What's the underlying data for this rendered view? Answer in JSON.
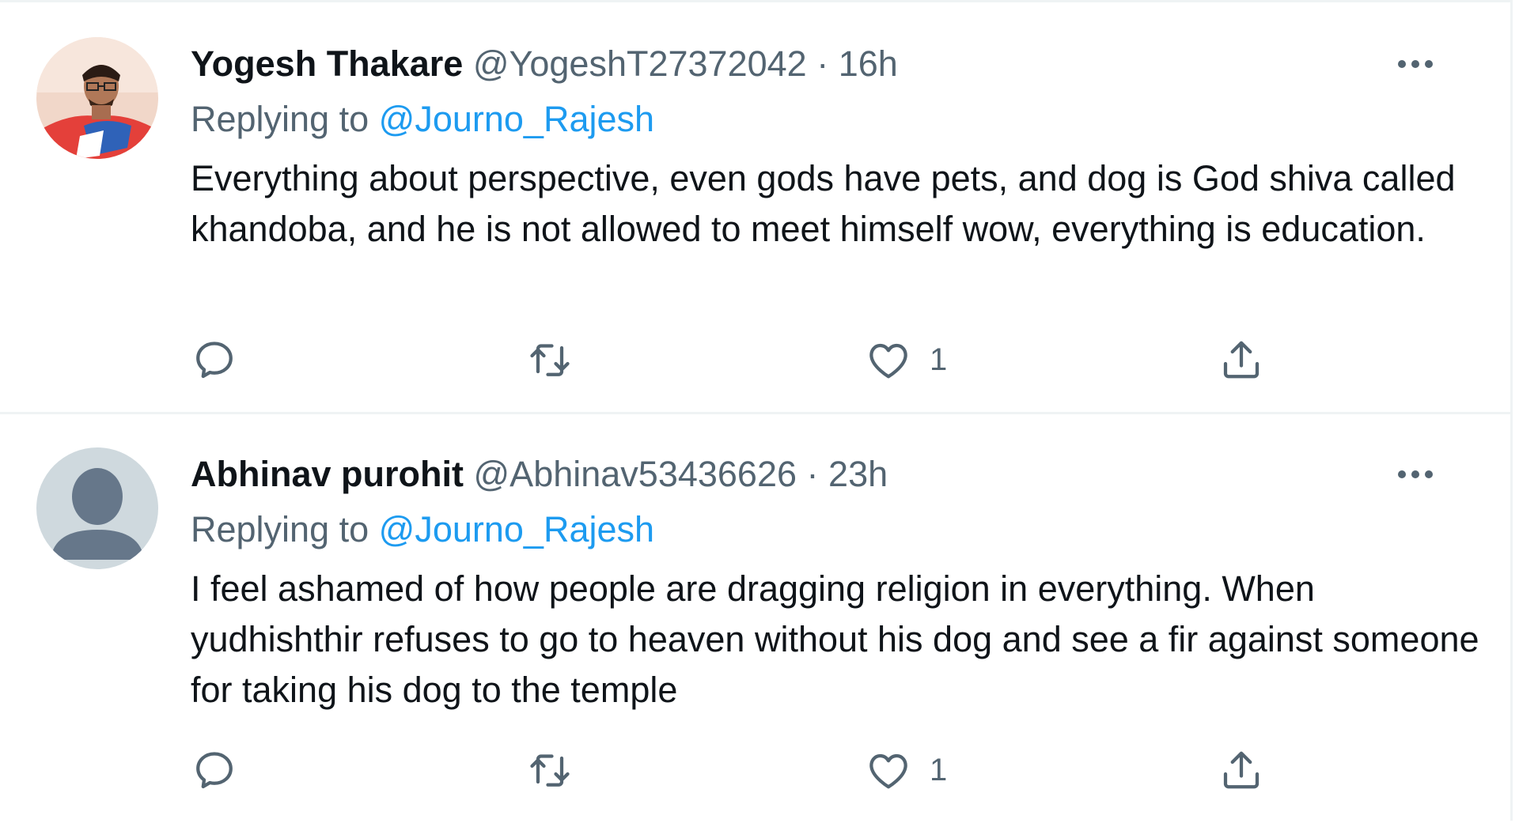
{
  "tweets": [
    {
      "display_name": "Yogesh Thakare",
      "handle": "@YogeshT27372042",
      "separator": "·",
      "time": "16h",
      "replying_prefix": "Replying to",
      "replying_to": "@Journo_Rajesh",
      "text": "Everything about perspective, even gods have pets, and dog is God shiva called khandoba, and he is not allowed to meet himself wow, everything is education.",
      "likes": "1",
      "avatar": "photo-avatar",
      "more_icon": "more-horizontal-icon"
    },
    {
      "display_name": "Abhinav purohit",
      "handle": "@Abhinav53436626",
      "separator": "·",
      "time": "23h",
      "replying_prefix": "Replying to",
      "replying_to": "@Journo_Rajesh",
      "text": "I feel ashamed of how people are dragging religion in everything. When yudhishthir refuses to go to heaven without his dog and see a fir against someone for taking his dog to the temple",
      "likes": "1",
      "avatar": "default-avatar",
      "more_icon": "more-horizontal-icon"
    }
  ],
  "icons": {
    "reply": "reply-icon",
    "retweet": "retweet-icon",
    "like": "heart-icon",
    "share": "share-icon"
  },
  "colors": {
    "text": "#0f1419",
    "secondary": "#536471",
    "link": "#1d9bf0",
    "divider": "#eff3f4",
    "default_avatar_bg": "#cfd9de",
    "default_avatar_fg": "#66778a"
  }
}
